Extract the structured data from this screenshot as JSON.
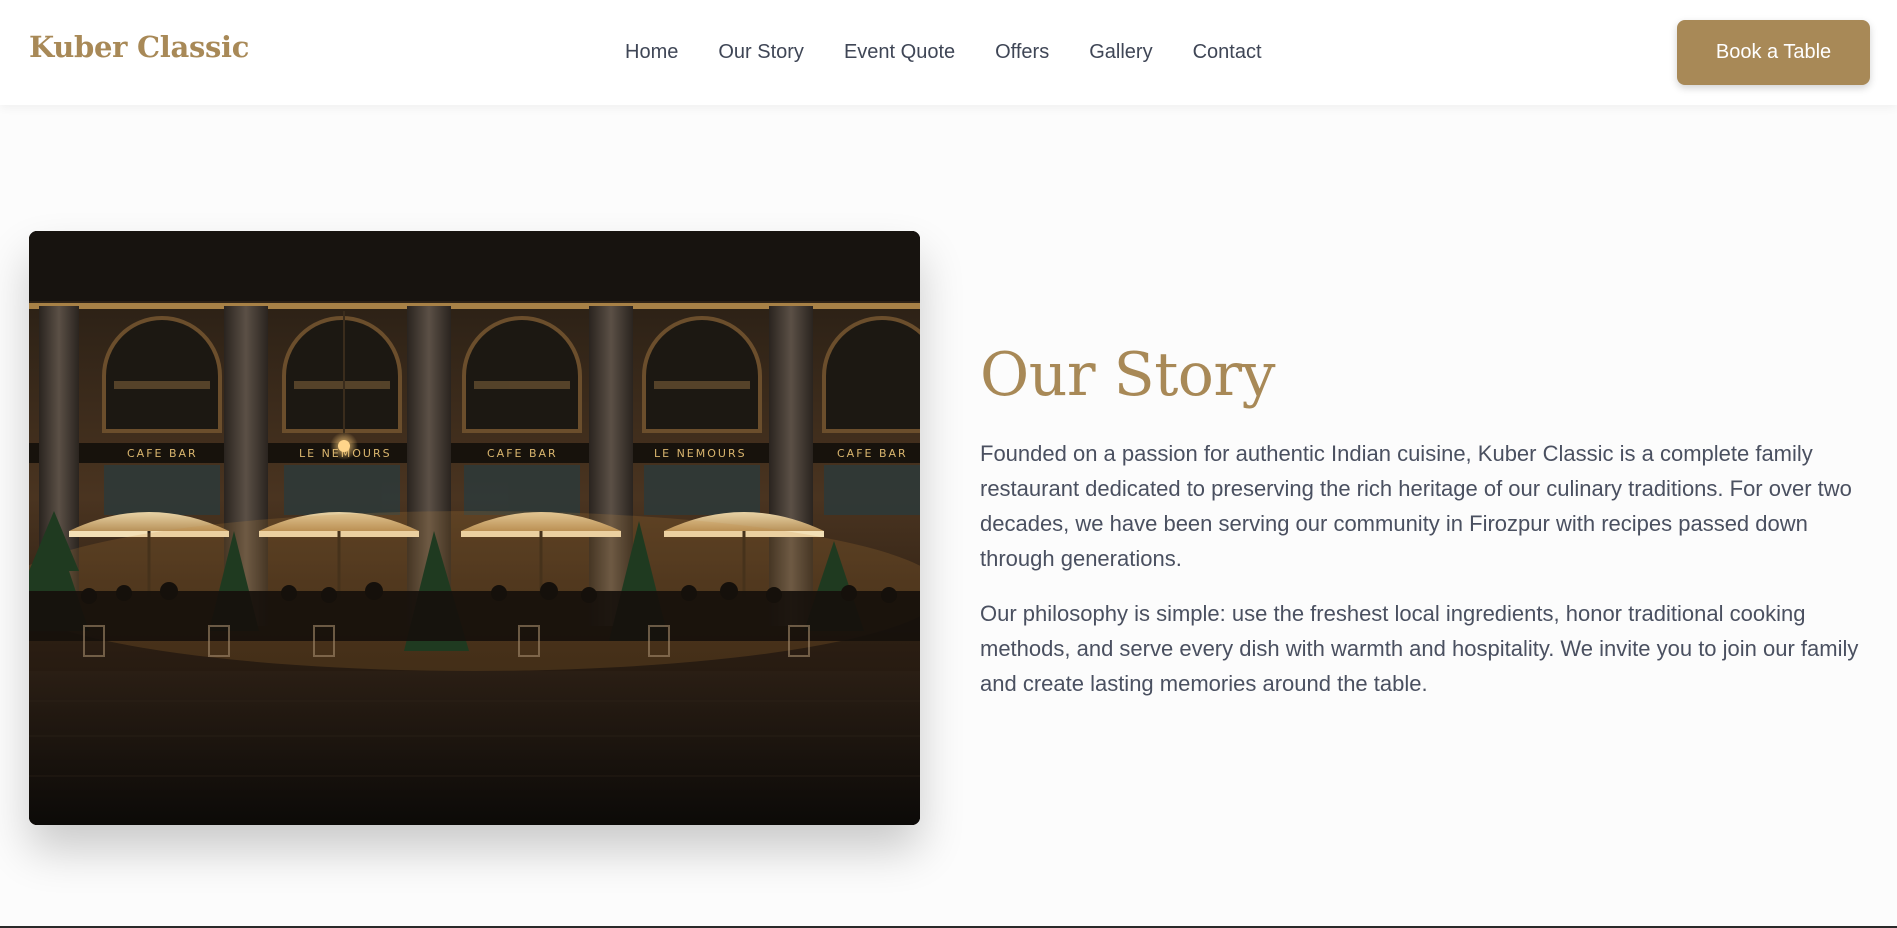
{
  "header": {
    "logo": "Kuber Classic",
    "nav": [
      {
        "label": "Home"
      },
      {
        "label": "Our Story"
      },
      {
        "label": "Event Quote"
      },
      {
        "label": "Offers"
      },
      {
        "label": "Gallery"
      },
      {
        "label": "Contact"
      }
    ],
    "cta_label": "Book a Table"
  },
  "story": {
    "title": "Our Story",
    "paragraphs": [
      "Founded on a passion for authentic Indian cuisine, Kuber Classic is a complete family restaurant dedicated to preserving the rich heritage of our culinary traditions. For over two decades, we have been serving our community in Firozpur with recipes passed down through generations.",
      "Our philosophy is simple: use the freshest local ingredients, honor traditional cooking methods, and serve every dish with warmth and hospitality. We invite you to join our family and create lasting memories around the table."
    ]
  },
  "photo": {
    "signs": [
      "CAFE BAR",
      "LE NEMOURS",
      "CAFE BAR",
      "LE NEMOURS",
      "CAFE BAR"
    ]
  },
  "colors": {
    "accent": "#a88957",
    "text": "#4a5060",
    "nav_text": "#3f4656",
    "background": "#fcfcfc"
  }
}
